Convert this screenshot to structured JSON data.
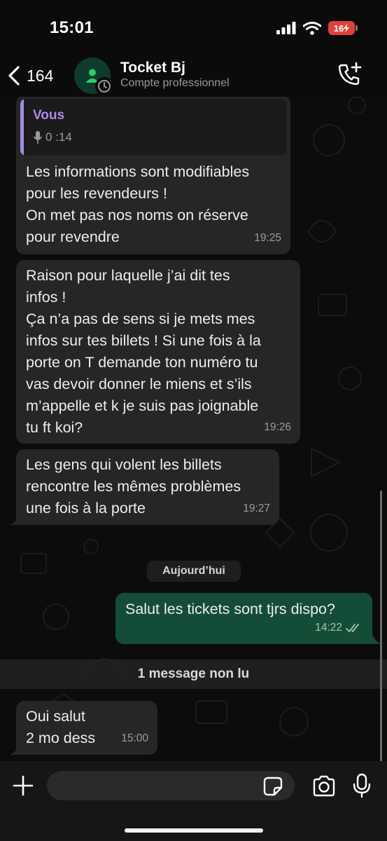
{
  "status_bar": {
    "time": "15:01",
    "battery": "16"
  },
  "header": {
    "back_count": "164",
    "contact_name": "Tocket Bj",
    "contact_subtitle": "Compte professionnel",
    "icons": [
      "chevron-left-icon",
      "person-icon",
      "add-call-icon"
    ]
  },
  "messages": [
    {
      "direction": "incoming",
      "quote": {
        "author": "Vous",
        "duration": "0 :14"
      },
      "text": "Les informations sont modifiables\npour les revendeurs !\nOn met pas nos noms on réserve\npour revendre",
      "time": "19:25"
    },
    {
      "direction": "incoming",
      "text": "Raison pour laquelle j’ai dit tes\ninfos !\nÇa n’a pas de sens si je mets mes\ninfos sur tes billets ! Si une fois à la\nporte on T demande ton numéro tu\nvas devoir donner le miens et s’ils\nm’appelle et k je suis pas joignable\ntu ft koi?",
      "time": "19:26"
    },
    {
      "direction": "incoming",
      "text": "Les gens qui volent les billets\nrencontre les mêmes problèmes\nune fois à la porte",
      "time": "19:27"
    },
    {
      "direction": "outgoing",
      "text": "Salut les tickets sont tjrs dispo?",
      "time": "14:22",
      "status": "read"
    },
    {
      "direction": "incoming",
      "text": "Oui salut\n2 mo dess",
      "time": "15:00"
    }
  ],
  "date_divider": "Aujourd’hui",
  "unread_divider": "1 message non lu",
  "input": {
    "placeholder": "",
    "value": "",
    "icons": [
      "plus-icon",
      "sticker-icon",
      "camera-icon",
      "microphone-icon"
    ]
  },
  "colors": {
    "incoming_bubble": "#262626",
    "outgoing_bubble": "#144d37",
    "quote_accent": "#a98be8",
    "avatar_icon": "#25d366",
    "battery_low": "#e0413a"
  }
}
